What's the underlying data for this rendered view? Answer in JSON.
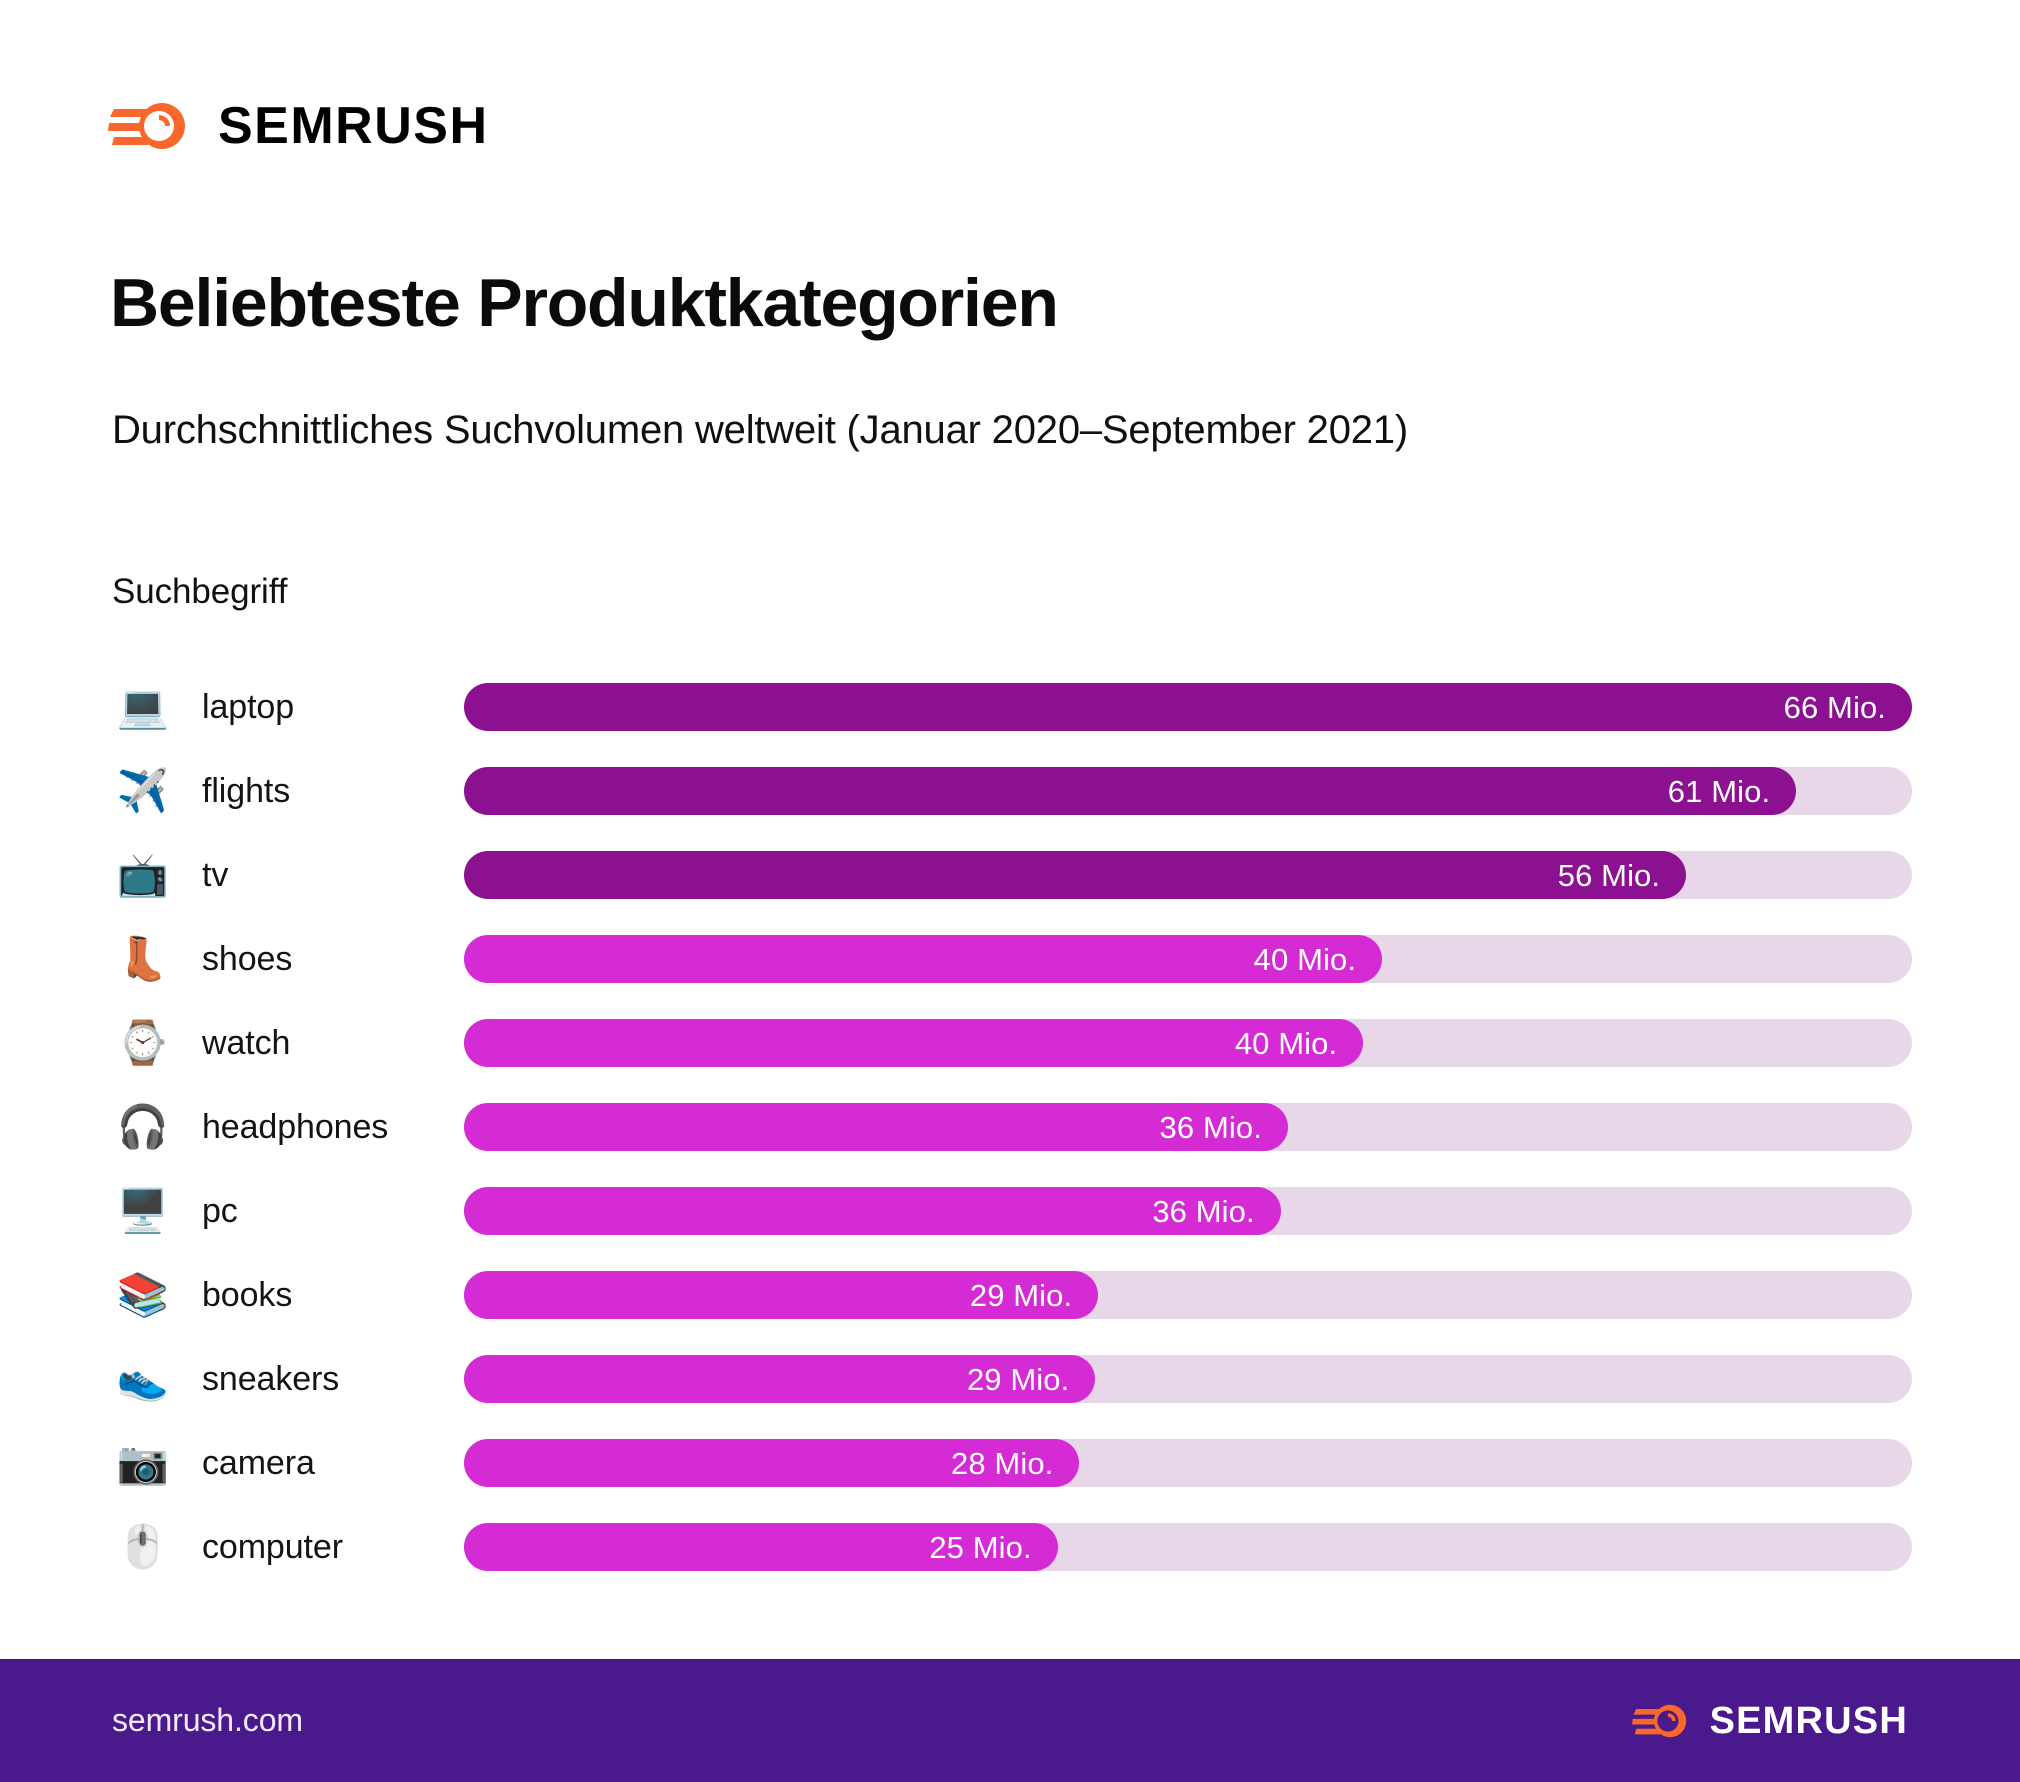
{
  "brand": {
    "name": "SEMRUSH",
    "accent_orange": "#f8682c",
    "footer_bg": "#4a1a8c",
    "bar_dark": "#8b1190",
    "bar_light": "#d42bd4",
    "track": "#e8d6e9"
  },
  "header": {
    "title": "Beliebteste Produktkategorien",
    "subtitle": "Durchschnittliches Suchvolumen weltweit (Januar 2020–September 2021)"
  },
  "chart_header": {
    "column_label": "Suchbegriff"
  },
  "footer": {
    "url": "semrush.com",
    "logo_word": "SEMRUSH"
  },
  "chart_data": {
    "type": "bar",
    "orientation": "horizontal",
    "title": "Beliebteste Produktkategorien",
    "subtitle": "Durchschnittliches Suchvolumen weltweit (Januar 2020–September 2021)",
    "xlabel": "",
    "ylabel": "Suchbegriff",
    "unit": "Mio.",
    "xlim": [
      0,
      66
    ],
    "grid": false,
    "legend": "none",
    "categories": [
      "laptop",
      "flights",
      "tv",
      "shoes",
      "watch",
      "headphones",
      "pc",
      "books",
      "sneakers",
      "camera",
      "computer"
    ],
    "values": [
      66,
      61,
      56,
      40,
      40,
      36,
      36,
      29,
      29,
      28,
      25
    ],
    "value_labels": [
      "66 Mio.",
      "61 Mio.",
      "56 Mio.",
      "40 Mio.",
      "40 Mio.",
      "36 Mio.",
      "36 Mio.",
      "29 Mio.",
      "29 Mio.",
      "28 Mio.",
      "25 Mio."
    ],
    "rows": [
      {
        "emoji": "💻",
        "icon_name": "laptop-emoji",
        "label": "laptop",
        "value": 66,
        "value_label": "66 Mio.",
        "percent": 100.0,
        "color": "dark"
      },
      {
        "emoji": "✈️",
        "icon_name": "airplane-emoji",
        "label": "flights",
        "value": 61,
        "value_label": "61 Mio.",
        "percent": 92.0,
        "color": "dark"
      },
      {
        "emoji": "📺",
        "icon_name": "television-emoji",
        "label": "tv",
        "value": 56,
        "value_label": "56 Mio.",
        "percent": 84.4,
        "color": "dark"
      },
      {
        "emoji": "👢",
        "icon_name": "boot-emoji",
        "label": "shoes",
        "value": 40,
        "value_label": "40 Mio.",
        "percent": 63.4,
        "color": "light"
      },
      {
        "emoji": "⌚",
        "icon_name": "watch-emoji",
        "label": "watch",
        "value": 40,
        "value_label": "40 Mio.",
        "percent": 62.1,
        "color": "light"
      },
      {
        "emoji": "🎧",
        "icon_name": "headphone-emoji",
        "label": "headphones",
        "value": 36,
        "value_label": "36 Mio.",
        "percent": 56.9,
        "color": "light"
      },
      {
        "emoji": "🖥️",
        "icon_name": "desktop-emoji",
        "label": "pc",
        "value": 36,
        "value_label": "36 Mio.",
        "percent": 56.4,
        "color": "light"
      },
      {
        "emoji": "📚",
        "icon_name": "books-emoji",
        "label": "books",
        "value": 29,
        "value_label": "29 Mio.",
        "percent": 43.8,
        "color": "light"
      },
      {
        "emoji": "👟",
        "icon_name": "sneaker-emoji",
        "label": "sneakers",
        "value": 29,
        "value_label": "29 Mio.",
        "percent": 43.6,
        "color": "light"
      },
      {
        "emoji": "📷",
        "icon_name": "camera-emoji",
        "label": "camera",
        "value": 28,
        "value_label": "28 Mio.",
        "percent": 42.5,
        "color": "light"
      },
      {
        "emoji": "🖱️",
        "icon_name": "mouse-emoji",
        "label": "computer",
        "value": 25,
        "value_label": "25 Mio.",
        "percent": 41.0,
        "color": "light"
      }
    ]
  }
}
